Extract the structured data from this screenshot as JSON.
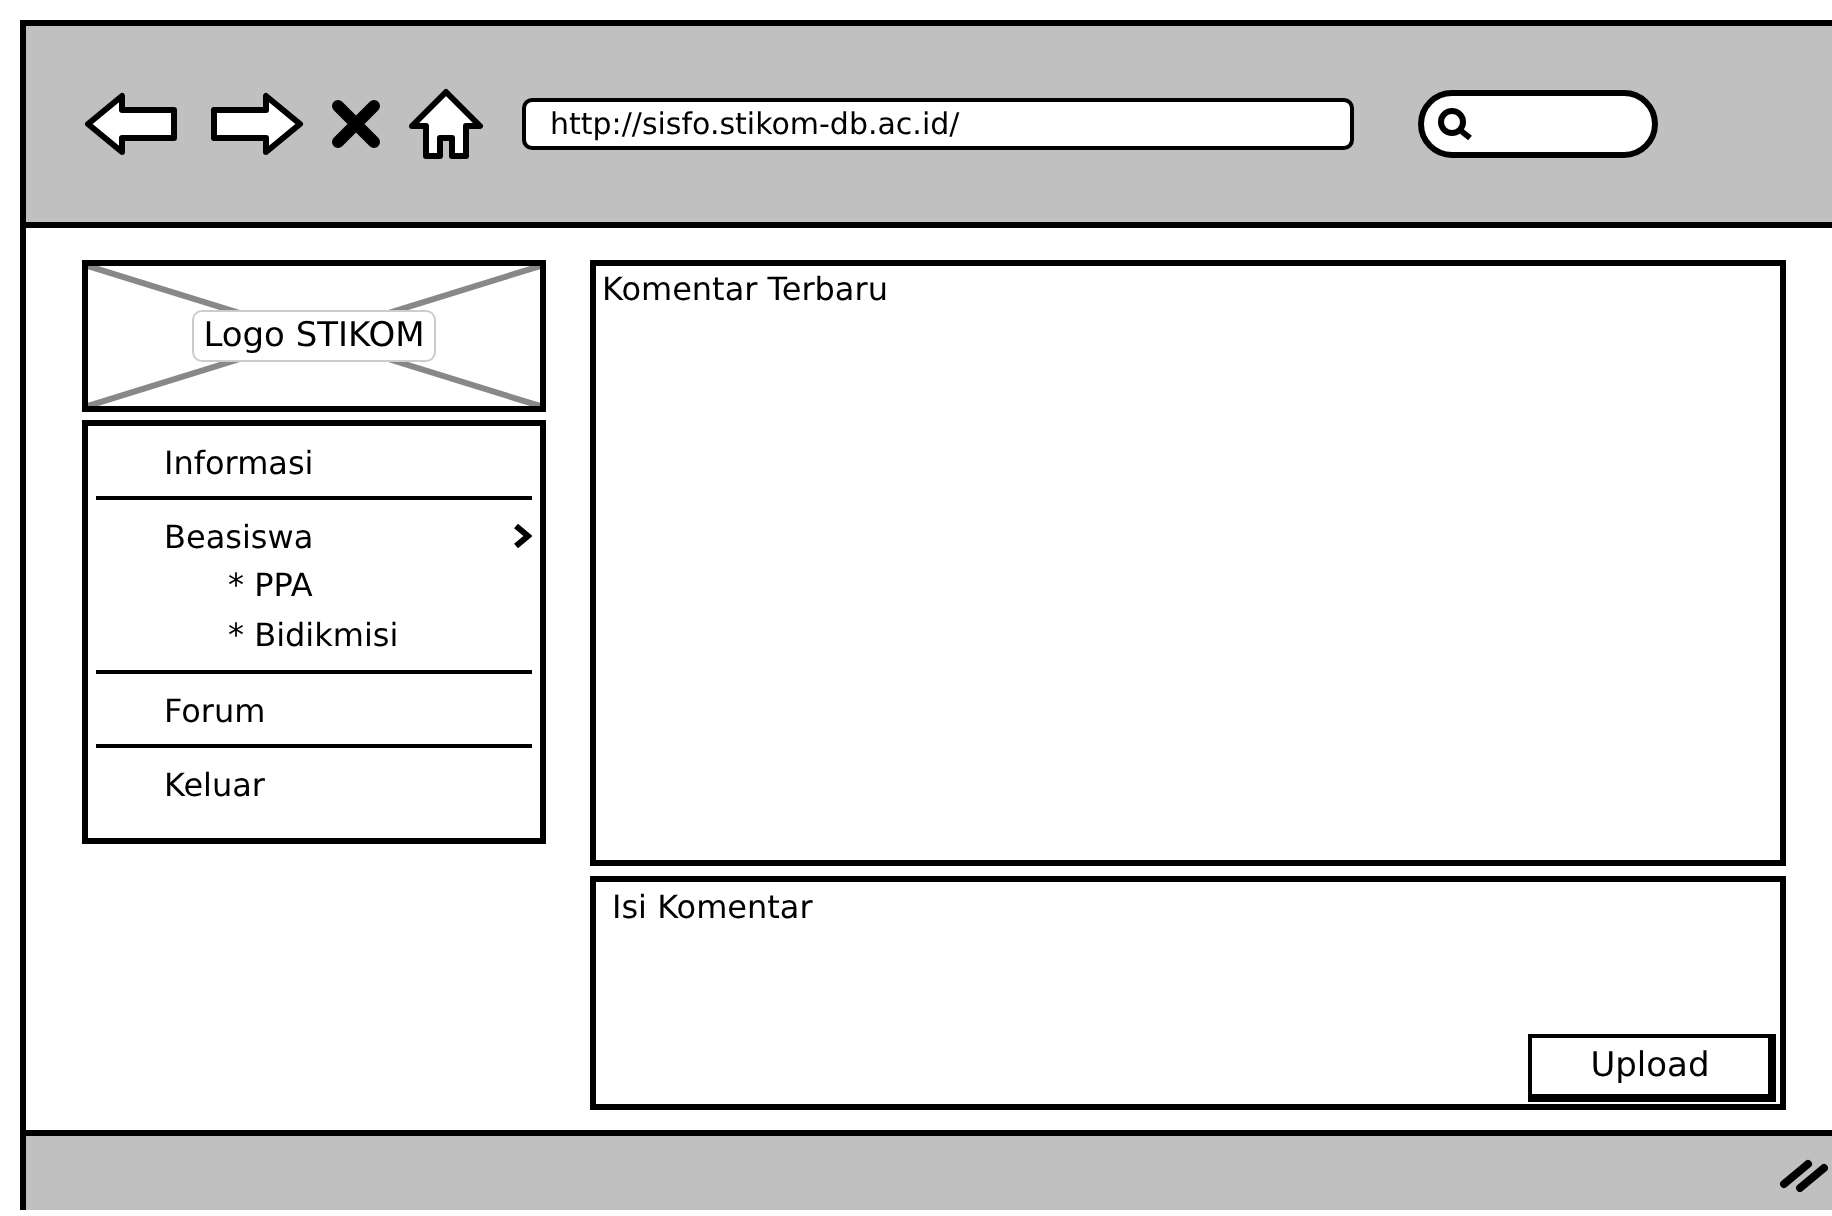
{
  "toolbar": {
    "url": "http://sisfo.stikom-db.ac.id/"
  },
  "logo": {
    "label": "Logo STIKOM"
  },
  "menu": [
    {
      "label": "Informasi"
    },
    {
      "label": "Beasiswa",
      "children": [
        {
          "label": "* PPA"
        },
        {
          "label": "* Bidikmisi"
        }
      ]
    },
    {
      "label": "Forum"
    },
    {
      "label": "Keluar"
    }
  ],
  "comments_panel": {
    "title": "Komentar Terbaru"
  },
  "comment_form": {
    "placeholder": "Isi Komentar",
    "button": "Upload"
  }
}
